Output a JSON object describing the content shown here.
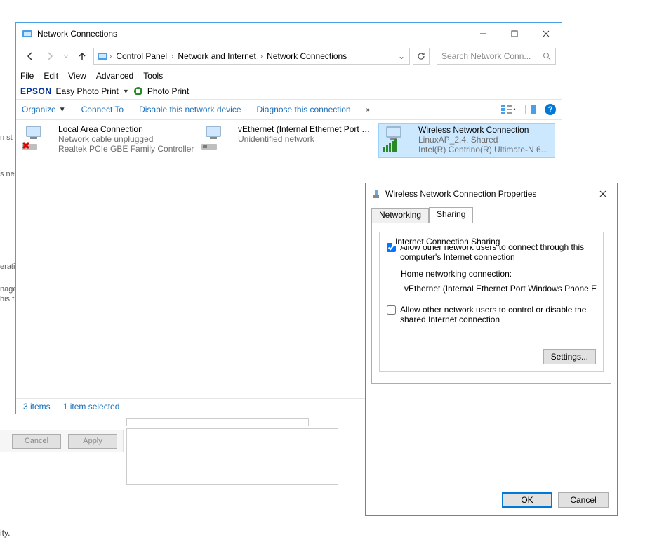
{
  "bg": {
    "left_fragments": [
      "n st",
      "s ne",
      "erati",
      "nage",
      "his f"
    ],
    "cancel": "Cancel",
    "apply": "Apply",
    "bottom_text": "ity."
  },
  "explorer": {
    "title": "Network Connections",
    "breadcrumb": [
      "Control Panel",
      "Network and Internet",
      "Network Connections"
    ],
    "search_placeholder": "Search Network Conn...",
    "menu": [
      "File",
      "Edit",
      "View",
      "Advanced",
      "Tools"
    ],
    "epson": {
      "logo": "EPSON",
      "easy": "Easy Photo Print",
      "photo": "Photo Print"
    },
    "toolbar": {
      "organize": "Organize",
      "connect_to": "Connect To",
      "disable": "Disable this network device",
      "diagnose": "Diagnose this connection"
    },
    "connections": [
      {
        "name": "Local Area Connection",
        "status": "Network cable unplugged",
        "device": "Realtek PCIe GBE Family Controller",
        "type": "lan-unplugged"
      },
      {
        "name": "vEthernet (Internal Ethernet Port Windows Phone Emulator Interna...",
        "status": "Unidentified network",
        "device": "",
        "type": "veth"
      },
      {
        "name": "Wireless Network Connection",
        "status": "LinuxAP_2.4, Shared",
        "device": "Intel(R) Centrino(R) Ultimate-N 6...",
        "type": "wifi",
        "selected": true
      }
    ],
    "status": {
      "items": "3 items",
      "selected": "1 item selected"
    }
  },
  "dialog": {
    "title": "Wireless Network Connection Properties",
    "tabs": [
      "Networking",
      "Sharing"
    ],
    "active_tab": 1,
    "group": "Internet Connection Sharing",
    "allow_connect": "Allow other network users to connect through this computer's Internet connection",
    "allow_connect_checked": true,
    "home_label": "Home networking connection:",
    "home_value": "vEthernet (Internal Ethernet Port Windows Phone Emulator",
    "allow_control": "Allow other network users to control or disable the shared Internet connection",
    "allow_control_checked": false,
    "settings": "Settings...",
    "ok": "OK",
    "cancel": "Cancel"
  }
}
